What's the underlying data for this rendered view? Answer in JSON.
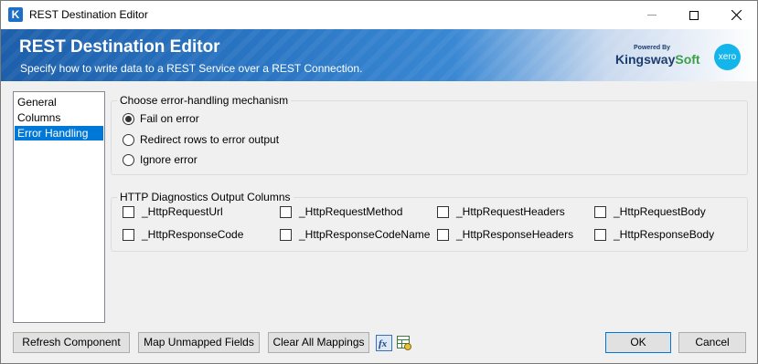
{
  "window": {
    "title": "REST Destination Editor",
    "app_icon_letter": "K"
  },
  "banner": {
    "title": "REST Destination Editor",
    "subtitle": "Specify how to write data to a REST Service over a REST Connection.",
    "kingsway_powered": "Powered By",
    "kingsway_name_a": "Kingsway",
    "kingsway_name_b": "Soft",
    "xero_label": "xero"
  },
  "nav": {
    "items": [
      {
        "label": "General"
      },
      {
        "label": "Columns"
      },
      {
        "label": "Error Handling"
      }
    ],
    "selected_index": 2
  },
  "error_handling": {
    "legend": "Choose error-handling mechanism",
    "options": [
      {
        "label": "Fail on error",
        "checked": true
      },
      {
        "label": "Redirect rows to error output",
        "checked": false
      },
      {
        "label": "Ignore error",
        "checked": false
      }
    ]
  },
  "diagnostics": {
    "legend": "HTTP Diagnostics Output Columns",
    "columns": [
      {
        "label": "_HttpRequestUrl",
        "checked": false
      },
      {
        "label": "_HttpRequestMethod",
        "checked": false
      },
      {
        "label": "_HttpRequestHeaders",
        "checked": false
      },
      {
        "label": "_HttpRequestBody",
        "checked": false
      },
      {
        "label": "_HttpResponseCode",
        "checked": false
      },
      {
        "label": "_HttpResponseCodeName",
        "checked": false
      },
      {
        "label": "_HttpResponseHeaders",
        "checked": false
      },
      {
        "label": "_HttpResponseBody",
        "checked": false
      }
    ]
  },
  "footer": {
    "refresh_label": "Refresh Component",
    "map_unmapped_label": "Map Unmapped Fields",
    "clear_mappings_label": "Clear All Mappings",
    "ok_label": "OK",
    "cancel_label": "Cancel",
    "fx_icon": "fx-icon",
    "settings_icon": "table-settings-icon"
  },
  "colors": {
    "accent": "#0078d7",
    "banner_dark": "#1d5faa",
    "xero": "#13b5ea"
  }
}
